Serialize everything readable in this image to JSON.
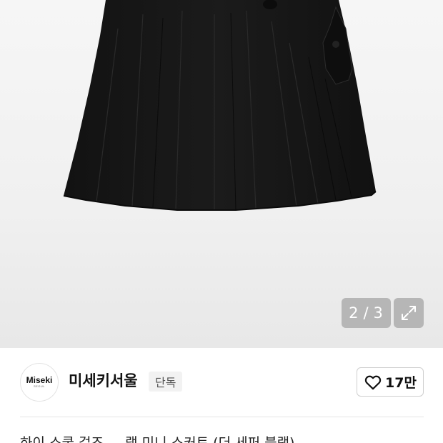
{
  "gallery": {
    "current": "2",
    "separator": "/",
    "total": "3",
    "expand_icon": "expand-arrows-icon"
  },
  "shop": {
    "logo_text": "Miseki",
    "logo_subtext": "SEOUL",
    "name": "미세키서울",
    "badge": "단독",
    "like_icon": "heart-outline-icon",
    "like_count": "17만"
  },
  "product": {
    "title_partial": "하이 스쿨 걸즈 ... 랩 미니 스커트 (더 세퍼 블랙)"
  },
  "colors": {
    "counter_bg": "#969696",
    "skirt": "#161616",
    "divider": "#e5e5e5"
  }
}
